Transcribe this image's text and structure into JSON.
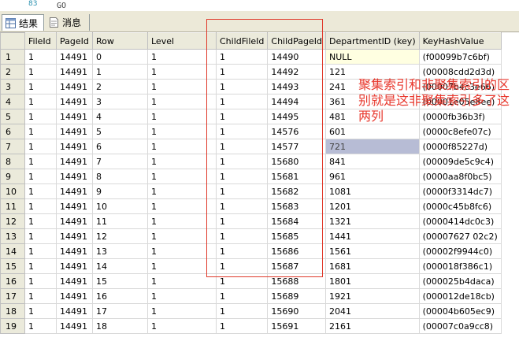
{
  "editor": {
    "line_number": "83",
    "code_fragment": "GO"
  },
  "tabs": [
    {
      "label": "结果",
      "icon": "grid-icon",
      "active": true
    },
    {
      "label": "消息",
      "icon": "message-icon",
      "active": false
    }
  ],
  "columns": [
    "",
    "FileId",
    "PageId",
    "Row",
    "Level",
    "ChildFileId",
    "ChildPageId",
    "DepartmentID (key)",
    "KeyHashValue"
  ],
  "rows": [
    [
      "1",
      "1",
      "14491",
      "0",
      "1",
      "1",
      "14490",
      "NULL",
      "(f00099b7c6bf)"
    ],
    [
      "2",
      "1",
      "14491",
      "1",
      "1",
      "1",
      "14492",
      "121",
      "(00008cdd2d3d)"
    ],
    [
      "3",
      "1",
      "14491",
      "2",
      "1",
      "1",
      "14493",
      "241",
      "(00007b4c3e66)"
    ],
    [
      "4",
      "1",
      "14491",
      "3",
      "1",
      "1",
      "14494",
      "361",
      "(00001e05e8ee)"
    ],
    [
      "5",
      "1",
      "14491",
      "4",
      "1",
      "1",
      "14495",
      "481",
      "(0000fb36b3f)"
    ],
    [
      "6",
      "1",
      "14491",
      "5",
      "1",
      "1",
      "14576",
      "601",
      "(0000c8efe07c)"
    ],
    [
      "7",
      "1",
      "14491",
      "6",
      "1",
      "1",
      "14577",
      "721",
      "(0000f85227d)"
    ],
    [
      "8",
      "1",
      "14491",
      "7",
      "1",
      "1",
      "15680",
      "841",
      "(00009de5c9c4)"
    ],
    [
      "9",
      "1",
      "14491",
      "8",
      "1",
      "1",
      "15681",
      "961",
      "(0000aa8f0bc5)"
    ],
    [
      "10",
      "1",
      "14491",
      "9",
      "1",
      "1",
      "15682",
      "1081",
      "(0000f3314dc7)"
    ],
    [
      "11",
      "1",
      "14491",
      "10",
      "1",
      "1",
      "15683",
      "1201",
      "(0000c45b8fc6)"
    ],
    [
      "12",
      "1",
      "14491",
      "11",
      "1",
      "1",
      "15684",
      "1321",
      "(0000414dc0c3)"
    ],
    [
      "13",
      "1",
      "14491",
      "12",
      "1",
      "1",
      "15685",
      "1441",
      "(00007627 02c2)"
    ],
    [
      "14",
      "1",
      "14491",
      "13",
      "1",
      "1",
      "15686",
      "1561",
      "(00002f9944c0)"
    ],
    [
      "15",
      "1",
      "14491",
      "14",
      "1",
      "1",
      "15687",
      "1681",
      "(000018f386c1)"
    ],
    [
      "16",
      "1",
      "14491",
      "15",
      "1",
      "1",
      "15688",
      "1801",
      "(000025b4daca)"
    ],
    [
      "17",
      "1",
      "14491",
      "16",
      "1",
      "1",
      "15689",
      "1921",
      "(000012de18cb)"
    ],
    [
      "18",
      "1",
      "14491",
      "17",
      "1",
      "1",
      "15690",
      "2041",
      "(00004b605ec9)"
    ],
    [
      "19",
      "1",
      "14491",
      "18",
      "1",
      "1",
      "15691",
      "2161",
      "(00007c0a9cc8)"
    ]
  ],
  "annotation": "聚集索引和非聚集索引的区别就是这非聚集索引多了这两列",
  "colors": {
    "annotation": "#e8372c",
    "header_bg": "#ebeadb",
    "selection": "#b7bcd5",
    "null_bg": "#ffffe1"
  }
}
